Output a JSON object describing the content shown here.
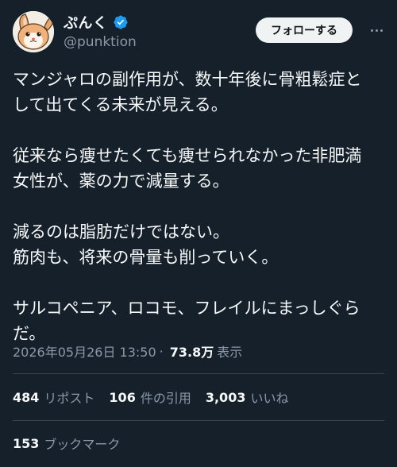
{
  "author": {
    "display_name": "ぷんく",
    "handle": "@punktion",
    "verified_icon": "verified-badge-icon",
    "avatar_icon": "rabbit-avatar"
  },
  "header": {
    "follow_label": "フォローする",
    "more_icon": "more-options-icon"
  },
  "tweet": {
    "lines": [
      "マンジャロの副作用が、数十年後に骨粗鬆症と",
      "して出てくる未来が見える。",
      "",
      "従来なら痩せたくても痩せられなかった非肥満",
      "女性が、薬の力で減量する。",
      "",
      "減るのは脂肪だけではない。",
      "筋肉も、将来の骨量も削っていく。",
      "",
      "サルコペニア、ロコモ、フレイルにまっしぐら",
      "だ。"
    ]
  },
  "meta": {
    "timestamp": "2026年05月26日 13:50",
    "separator": "·",
    "views_count": "73.8万",
    "views_label": "表示"
  },
  "stats": {
    "reposts_count": "484",
    "reposts_label": "リポスト",
    "quotes_count": "106",
    "quotes_label": "件の引用",
    "likes_count": "3,003",
    "likes_label": "いいね",
    "bookmarks_count": "153",
    "bookmarks_label": "ブックマーク"
  },
  "colors": {
    "background": "#15202b",
    "text_primary": "#f7f9f9",
    "text_secondary": "#8b98a5",
    "divider": "#38444d",
    "verified": "#1d9bf0",
    "follow_bg": "#eff3f4"
  }
}
